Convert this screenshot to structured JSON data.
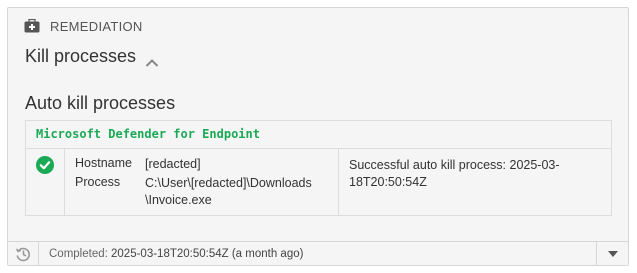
{
  "header": {
    "label": "REMEDIATION",
    "icon": "first-aid-kit-icon"
  },
  "section": {
    "title": "Kill processes",
    "toggle_icon": "chevron-up-icon"
  },
  "subsection": {
    "title": "Auto kill processes"
  },
  "table": {
    "provider": "Microsoft Defender for Endpoint",
    "rows": [
      {
        "status_icon": "check-circle-icon",
        "status_color": "#1aaa55",
        "hostname_label": "Hostname",
        "hostname_value": "[redacted]",
        "process_label": "Process",
        "process_value_line1": "C:\\User\\[redacted]\\Downloads",
        "process_value_line2": "\\Invoice.exe",
        "result": "Successful auto kill process: 2025-03-18T20:50:54Z"
      }
    ]
  },
  "footer": {
    "label": "Completed:",
    "value": "2025-03-18T20:50:54Z (a month ago)",
    "history_icon": "history-icon",
    "dropdown_icon": "caret-down-icon"
  }
}
